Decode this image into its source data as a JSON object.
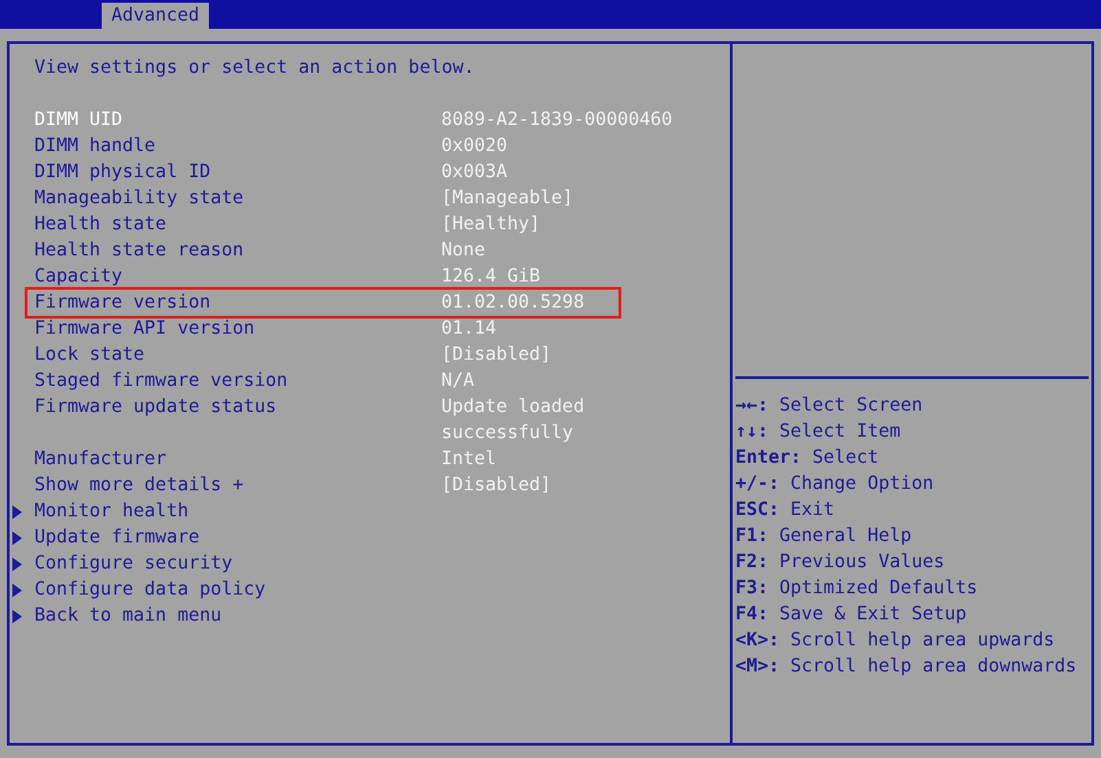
{
  "tabs": [
    {
      "label": "Advanced",
      "selected": true
    }
  ],
  "description": "View settings or select an action below.",
  "rows": [
    {
      "kind": "info",
      "label": "DIMM UID",
      "value": "8089-A2-1839-00000460",
      "selected": true,
      "highlighted": false
    },
    {
      "kind": "info",
      "label": "DIMM handle",
      "value": "0x0020",
      "selected": false,
      "highlighted": false
    },
    {
      "kind": "info",
      "label": "DIMM physical ID",
      "value": "0x003A",
      "selected": false,
      "highlighted": false
    },
    {
      "kind": "info",
      "label": "Manageability state",
      "value": "[Manageable]",
      "selected": false,
      "highlighted": false
    },
    {
      "kind": "info",
      "label": "Health state",
      "value": "[Healthy]",
      "selected": false,
      "highlighted": false
    },
    {
      "kind": "info",
      "label": "Health state reason",
      "value": "None",
      "selected": false,
      "highlighted": false
    },
    {
      "kind": "info",
      "label": "Capacity",
      "value": "126.4 GiB",
      "selected": false,
      "highlighted": false
    },
    {
      "kind": "info",
      "label": "Firmware version",
      "value": "01.02.00.5298",
      "selected": false,
      "highlighted": true
    },
    {
      "kind": "info",
      "label": "Firmware API version",
      "value": "01.14",
      "selected": false,
      "highlighted": false
    },
    {
      "kind": "info",
      "label": "Lock state",
      "value": "[Disabled]",
      "selected": false,
      "highlighted": false
    },
    {
      "kind": "info",
      "label": "Staged firmware version",
      "value": "N/A",
      "selected": false,
      "highlighted": false
    },
    {
      "kind": "info",
      "label": "Firmware update status",
      "value": "Update loaded successfully",
      "selected": false,
      "highlighted": false
    },
    {
      "kind": "info",
      "label": "Manufacturer",
      "value": "Intel",
      "selected": false,
      "highlighted": false
    },
    {
      "kind": "info",
      "label": "Show more details +",
      "value": "[Disabled]",
      "selected": false,
      "highlighted": false
    },
    {
      "kind": "submenu",
      "label": "Monitor health",
      "selected": false,
      "highlighted": false
    },
    {
      "kind": "submenu",
      "label": "Update firmware",
      "selected": false,
      "highlighted": false
    },
    {
      "kind": "submenu",
      "label": "Configure security",
      "selected": false,
      "highlighted": false
    },
    {
      "kind": "submenu",
      "label": "Configure data policy",
      "selected": false,
      "highlighted": false
    },
    {
      "kind": "submenu",
      "label": "Back to main menu",
      "selected": false,
      "highlighted": false
    }
  ],
  "help": [
    {
      "key": "→←:",
      "text": "Select Screen"
    },
    {
      "key": "↑↓:",
      "text": "Select Item"
    },
    {
      "key": "Enter:",
      "text": "Select"
    },
    {
      "key": "+/-:",
      "text": "Change Option"
    },
    {
      "key": "ESC:",
      "text": "Exit"
    },
    {
      "key": "F1:",
      "text": "General Help"
    },
    {
      "key": "F2:",
      "text": "Previous Values"
    },
    {
      "key": "F3:",
      "text": "Optimized Defaults"
    },
    {
      "key": "F4:",
      "text": "Save & Exit Setup"
    },
    {
      "key": "<K>:",
      "text": "Scroll help area upwards"
    },
    {
      "key": "<M>:",
      "text": "Scroll help area downwards"
    }
  ]
}
